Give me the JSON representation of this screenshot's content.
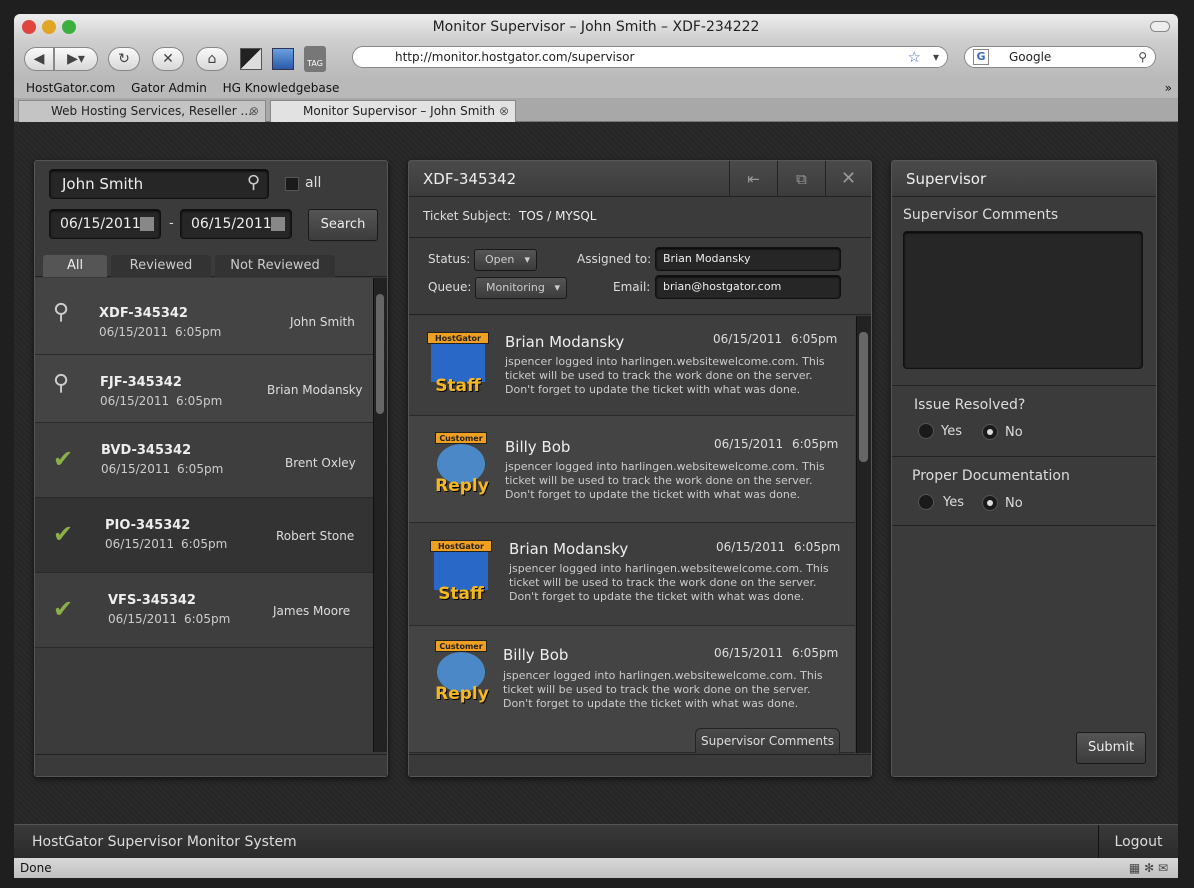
{
  "window": {
    "title": "Monitor Supervisor – John Smith – XDF-234222"
  },
  "browser": {
    "url": "http://monitor.hostgator.com/supervisor",
    "search_engine": "Google",
    "bookmarks": [
      "HostGator.com",
      "Gator Admin",
      "HG Knowledgebase"
    ],
    "tabs": [
      {
        "label": "Web Hosting Services, Reseller ..."
      },
      {
        "label": "Monitor Supervisor – John Smith"
      }
    ],
    "status": "Done"
  },
  "left": {
    "search_value": "John Smith",
    "all_label": "all",
    "date_from": "06/15/2011",
    "date_sep": "-",
    "date_to": "06/15/2011",
    "search_button": "Search",
    "filter_tabs": [
      "All",
      "Reviewed",
      "Not Reviewed"
    ],
    "tickets": [
      {
        "id": "XDF-345342",
        "date": "06/15/2011",
        "time": "6:05pm",
        "assignee": "John Smith",
        "icon": "magnifier-icon"
      },
      {
        "id": "FJF-345342",
        "date": "06/15/2011",
        "time": "6:05pm",
        "assignee": "Brian Modansky",
        "icon": "magnifier-icon"
      },
      {
        "id": "BVD-345342",
        "date": "06/15/2011",
        "time": "6:05pm",
        "assignee": "Brent Oxley",
        "icon": "check-icon"
      },
      {
        "id": "PIO-345342",
        "date": "06/15/2011",
        "time": "6:05pm",
        "assignee": "Robert Stone",
        "icon": "check-icon"
      },
      {
        "id": "VFS-345342",
        "date": "06/15/2011",
        "time": "6:05pm",
        "assignee": "James Moore",
        "icon": "check-icon"
      }
    ]
  },
  "ticket": {
    "id": "XDF-345342",
    "subject_label": "Ticket Subject:",
    "subject": "TOS / MYSQL",
    "status_label": "Status:",
    "status": "Open",
    "queue_label": "Queue:",
    "queue": "Monitoring",
    "assigned_label": "Assigned to:",
    "assigned": "Brian Modansky",
    "email_label": "Email:",
    "email": "brian@hostgator.com",
    "messages": [
      {
        "avatar": "staff",
        "badge_top": "HostGator",
        "badge_bottom": "Staff",
        "name": "Brian Modansky",
        "date": "06/15/2011",
        "time": "6:05pm",
        "body": "jspencer logged into harlingen.websitewelcome.com. This ticket will be used to track the work done on the server. Don't forget to update the ticket with what was done."
      },
      {
        "avatar": "customer",
        "badge_top": "Customer",
        "badge_bottom": "Reply",
        "name": "Billy Bob",
        "date": "06/15/2011",
        "time": "6:05pm",
        "body": "jspencer logged into harlingen.websitewelcome.com. This ticket will be used to track the work done on the server. Don't forget to update the ticket with what was done."
      },
      {
        "avatar": "staff",
        "badge_top": "HostGator",
        "badge_bottom": "Staff",
        "name": "Brian Modansky",
        "date": "06/15/2011",
        "time": "6:05pm",
        "body": "jspencer logged into harlingen.websitewelcome.com. This ticket will be used to track the work done on the server. Don't forget to update the ticket with what was done."
      },
      {
        "avatar": "customer",
        "badge_top": "Customer",
        "badge_bottom": "Reply",
        "name": "Billy Bob",
        "date": "06/15/2011",
        "time": "6:05pm",
        "body": "jspencer logged into harlingen.websitewelcome.com. This ticket will be used to track the work done on the server. Don't forget to update the ticket with what was done."
      }
    ],
    "supervisor_comments_tab": "Supervisor Comments"
  },
  "supervisor": {
    "title": "Supervisor",
    "comments_label": "Supervisor Comments",
    "issue_label": "Issue Resolved?",
    "doc_label": "Proper Documentation",
    "yes": "Yes",
    "no": "No",
    "issue_value": "No",
    "doc_value": "No",
    "submit": "Submit"
  },
  "footer": {
    "title": "HostGator Supervisor Monitor System",
    "logout": "Logout"
  }
}
